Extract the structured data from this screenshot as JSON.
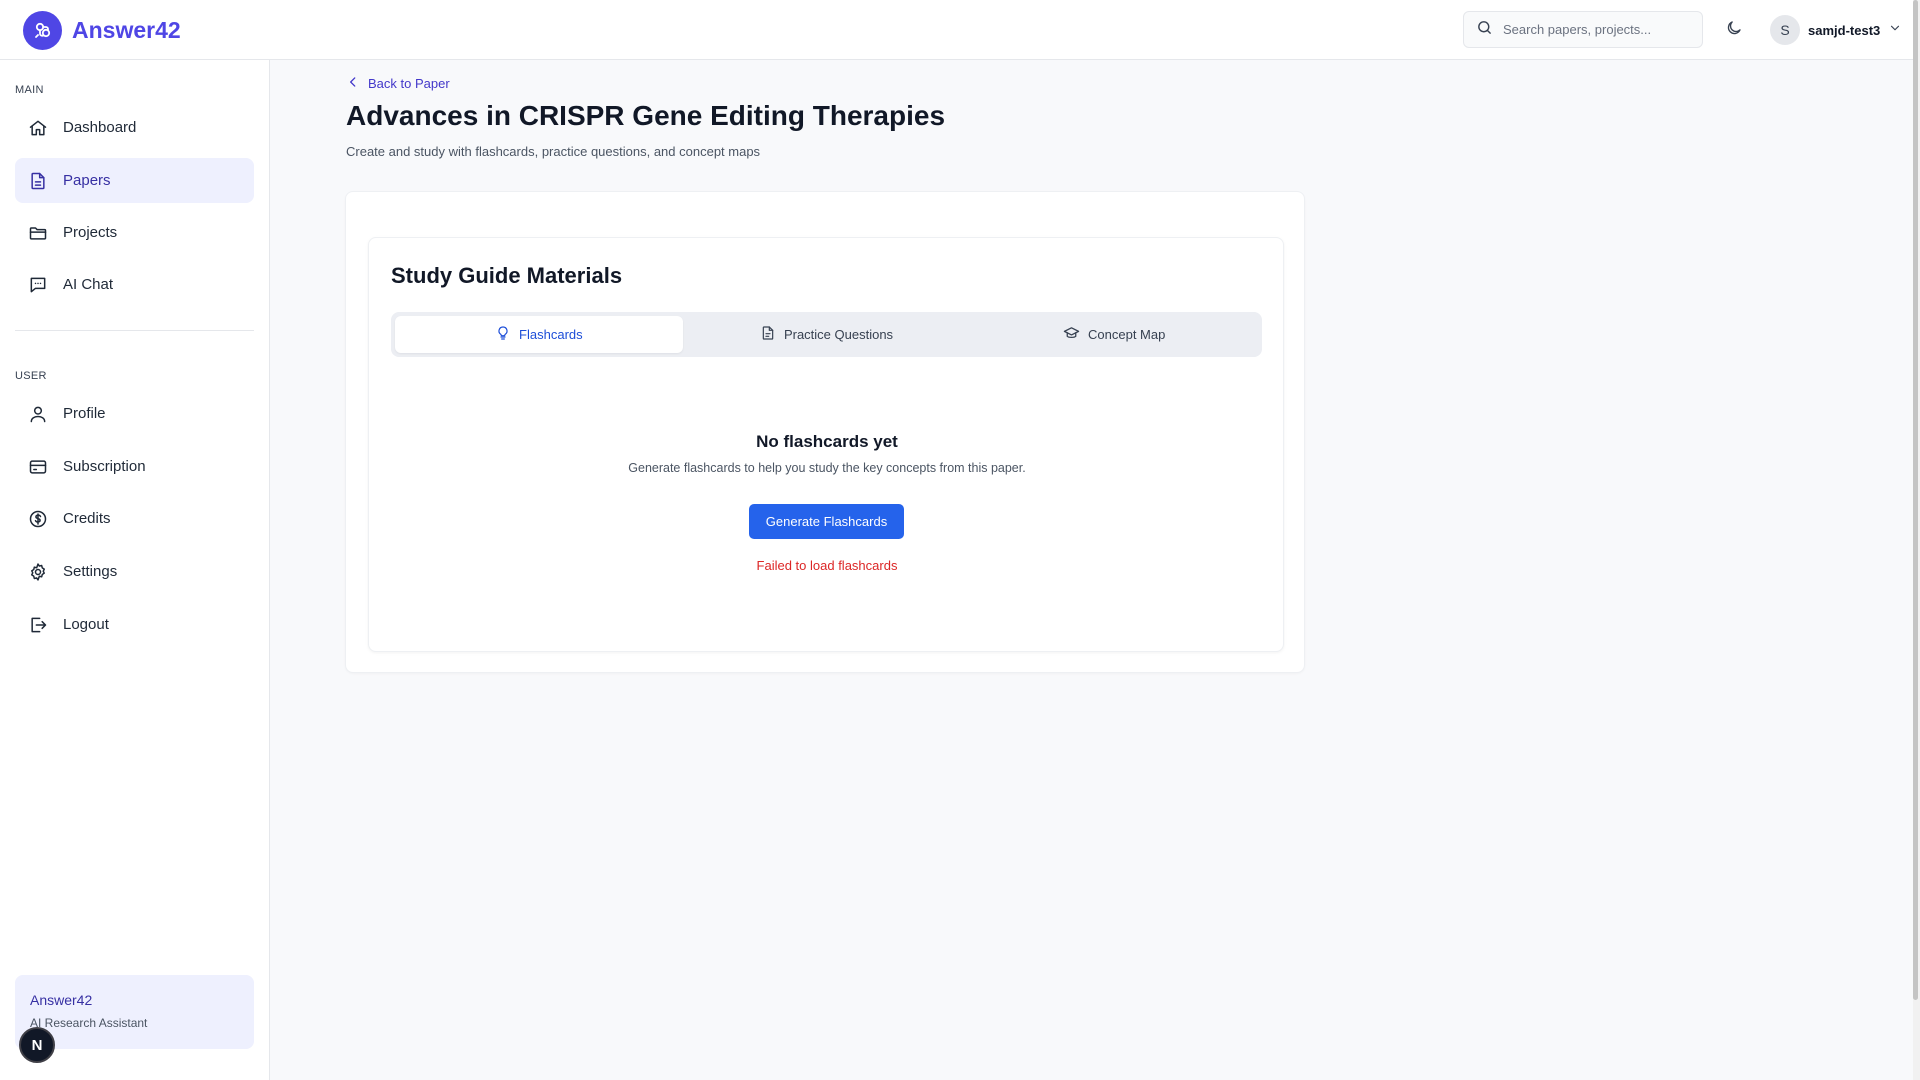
{
  "app": {
    "name": "Answer42",
    "tagline": "AI Research Assistant",
    "accent": "#4f46e5"
  },
  "header": {
    "search_placeholder": "Search papers, projects...",
    "user": {
      "initial": "S",
      "name": "samjd-test3"
    }
  },
  "sidebar": {
    "main_label": "MAIN",
    "main_items": [
      {
        "label": "Dashboard",
        "icon": "home-icon"
      },
      {
        "label": "Papers",
        "icon": "document-icon",
        "active": true
      },
      {
        "label": "Projects",
        "icon": "folder-icon"
      },
      {
        "label": "AI Chat",
        "icon": "chat-icon"
      }
    ],
    "user_label": "USER",
    "user_items": [
      {
        "label": "Profile",
        "icon": "user-icon"
      },
      {
        "label": "Subscription",
        "icon": "credit-card-icon"
      },
      {
        "label": "Credits",
        "icon": "dollar-icon"
      },
      {
        "label": "Settings",
        "icon": "gear-icon"
      },
      {
        "label": "Logout",
        "icon": "logout-icon"
      }
    ],
    "footer": {
      "title": "Answer42",
      "subtitle": "AI Research Assistant"
    },
    "badge": "N"
  },
  "page": {
    "back_label": "Back to Paper",
    "title": "Advances in CRISPR Gene Editing Therapies",
    "subtitle": "Create and study with flashcards, practice questions, and concept maps"
  },
  "study_guide": {
    "title": "Study Guide Materials",
    "tabs": [
      {
        "label": "Flashcards",
        "icon": "lightbulb-icon",
        "active": true
      },
      {
        "label": "Practice Questions",
        "icon": "file-icon"
      },
      {
        "label": "Concept Map",
        "icon": "graduation-cap-icon"
      }
    ],
    "empty_title": "No flashcards yet",
    "empty_description": "Generate flashcards to help you study the key concepts from this paper.",
    "generate_button": "Generate Flashcards",
    "error_message": "Failed to load flashcards",
    "button_color": "#2563eb",
    "error_color": "#dc2626"
  }
}
